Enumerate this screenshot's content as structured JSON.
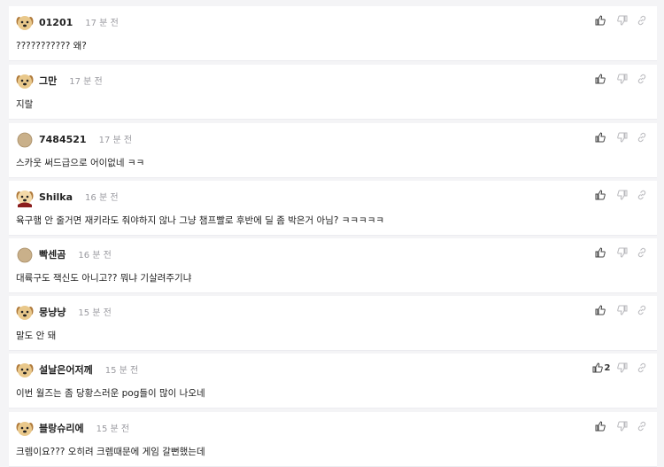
{
  "comments": [
    {
      "nick": "01201",
      "time": "17 분 전",
      "text": "??????????? 왜?",
      "avatar": "dog-avatar",
      "likes": ""
    },
    {
      "nick": "그만",
      "time": "17 분 전",
      "text": "지랄",
      "avatar": "dog-avatar",
      "likes": ""
    },
    {
      "nick": "7484521",
      "time": "17 분 전",
      "text": "스카웃 써드급으로 어이없네 ㅋㅋ",
      "avatar": "default-avatar",
      "likes": ""
    },
    {
      "nick": "Shilka",
      "time": "16 분 전",
      "text": "육구햄 안 줄거면 재키라도 줘야하지 않나 그냥 챔프빨로 후반에 딜 좀 박은거 아님? ㅋㅋㅋㅋㅋ",
      "avatar": "dog-red-avatar",
      "likes": ""
    },
    {
      "nick": "빡센곰",
      "time": "16 분 전",
      "text": "대륙구도 잭신도 아니고?? 뭐냐 기살려주기냐",
      "avatar": "default-avatar",
      "likes": ""
    },
    {
      "nick": "뭉냥냥",
      "time": "15 분 전",
      "text": "말도 안 돼",
      "avatar": "dog-avatar",
      "likes": ""
    },
    {
      "nick": "설날은어저께",
      "time": "15 분 전",
      "text": "이번 월즈는 좀 당황스러운 pog들이 많이 나오네",
      "avatar": "dog-avatar",
      "likes": "2"
    },
    {
      "nick": "블랑슈리에",
      "time": "15 분 전",
      "text": "크렘이요??? 오히려 크렘때문에 게임 갈뻔했는데",
      "avatar": "dog-alt-avatar",
      "likes": ""
    }
  ],
  "colors": {
    "accent": "#222222",
    "muted": "#9a9aa0",
    "icon": "#555555",
    "icon_light": "#b8b8bc"
  }
}
